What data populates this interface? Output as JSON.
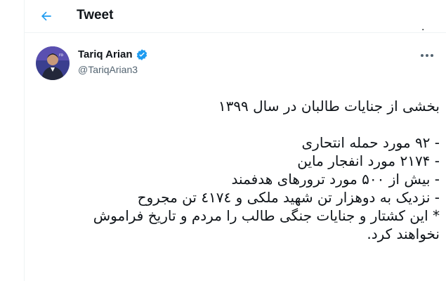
{
  "header": {
    "title": "Tweet",
    "back_icon": "arrow-left-icon",
    "trailing_text": "."
  },
  "tweet": {
    "author": {
      "name": "Tariq Arian",
      "handle": "@TariqArian3",
      "verified": true,
      "verified_icon": "verified-badge-icon"
    },
    "more_icon": "more-horizontal-icon",
    "title_line": "بخشی از جنایات طالبان در سال ۱۳۹۹",
    "lines": [
      "- ۹۲ مورد حمله انتحاری",
      "- ۲۱۷۴ مورد انفجار ماین",
      "- بیش از ۵۰۰ مورد ترورهای هدفمند",
      "- نزدیک به دوهزار تن شهید ملکی و ٤١٧٤ تن مجروح",
      "* این کشتار و جنایات جنگی طالب را مردم و تاریخ فراموش",
      "نخواهند کرد."
    ]
  },
  "colors": {
    "accent": "#1d9bf0",
    "text": "#0f1419",
    "muted": "#536471",
    "border": "#eff3f4"
  }
}
